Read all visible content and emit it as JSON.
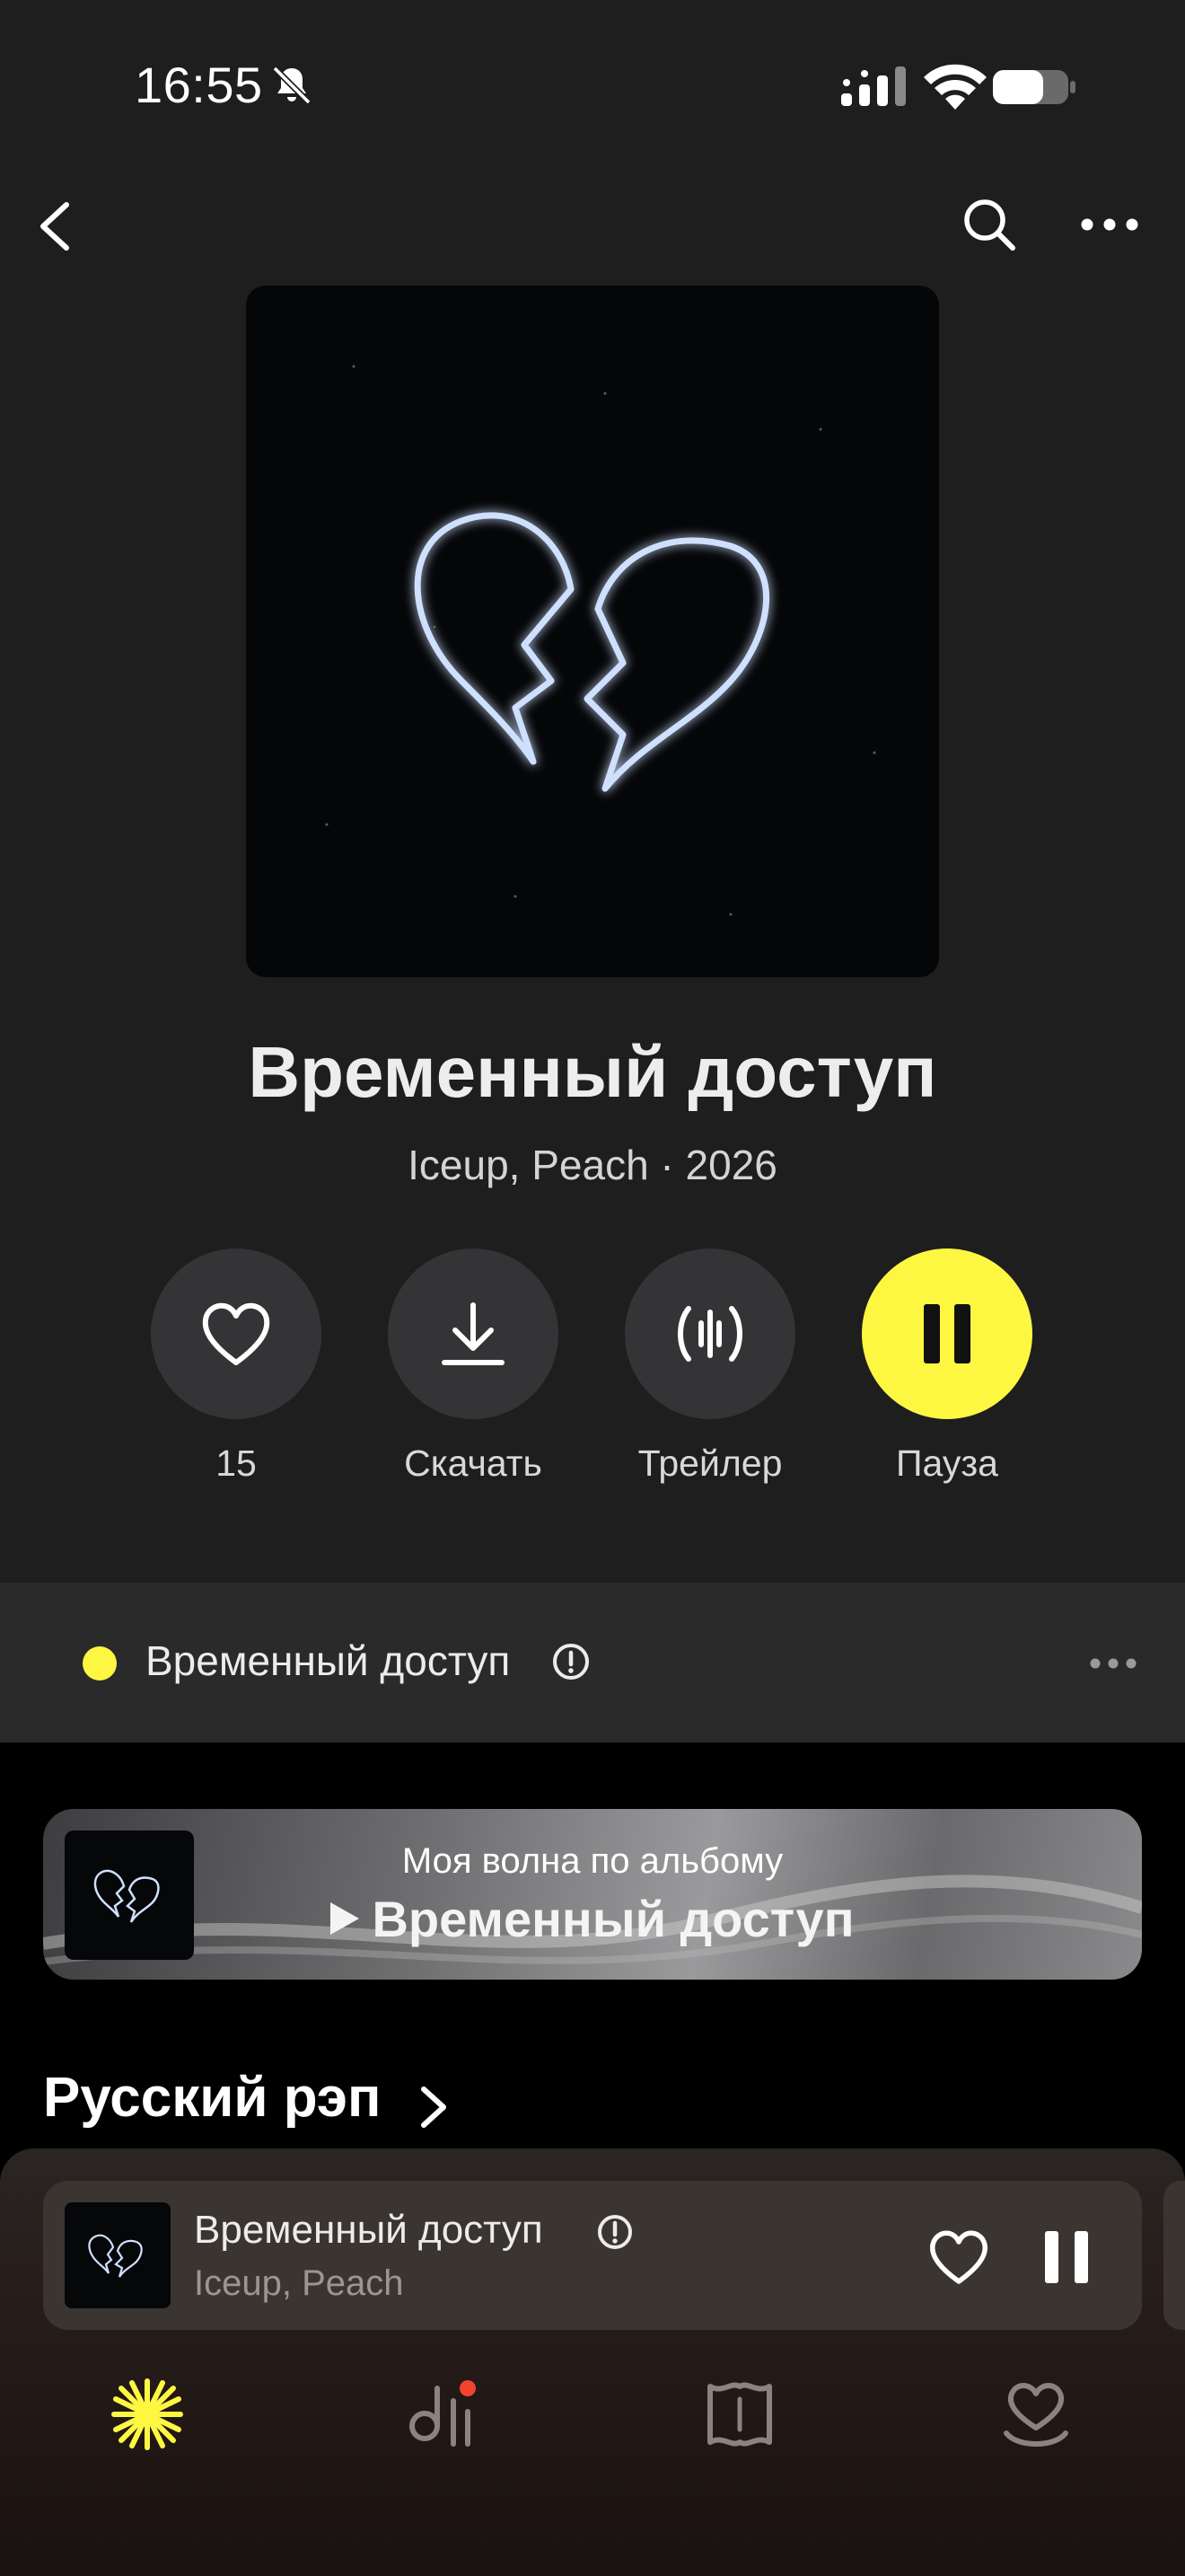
{
  "status_bar": {
    "time": "16:55"
  },
  "album": {
    "title": "Временный доступ",
    "subtitle": "Iceup, Peach · 2026"
  },
  "actions": [
    {
      "label": "15"
    },
    {
      "label": "Скачать"
    },
    {
      "label": "Трейлер"
    },
    {
      "label": "Пауза"
    }
  ],
  "now_playing_row": {
    "title": "Временный доступ"
  },
  "wave": {
    "subtitle": "Моя волна по альбому",
    "title": "Временный доступ"
  },
  "section": {
    "title": "Русский рэп"
  },
  "mini_player": {
    "title": "Временный доступ",
    "artist": "Iceup, Peach"
  },
  "colors": {
    "accent": "#fdf742",
    "background": "#1e1e1f",
    "notification_dot": "#f0442f"
  },
  "icons": [
    "back-icon",
    "search-icon",
    "more-icon",
    "heart-icon",
    "download-icon",
    "trailer-icon",
    "pause-icon",
    "info-icon",
    "chevron-right-icon",
    "wave-tab-icon",
    "collection-tab-icon",
    "map-tab-icon",
    "heart-tab-icon"
  ]
}
